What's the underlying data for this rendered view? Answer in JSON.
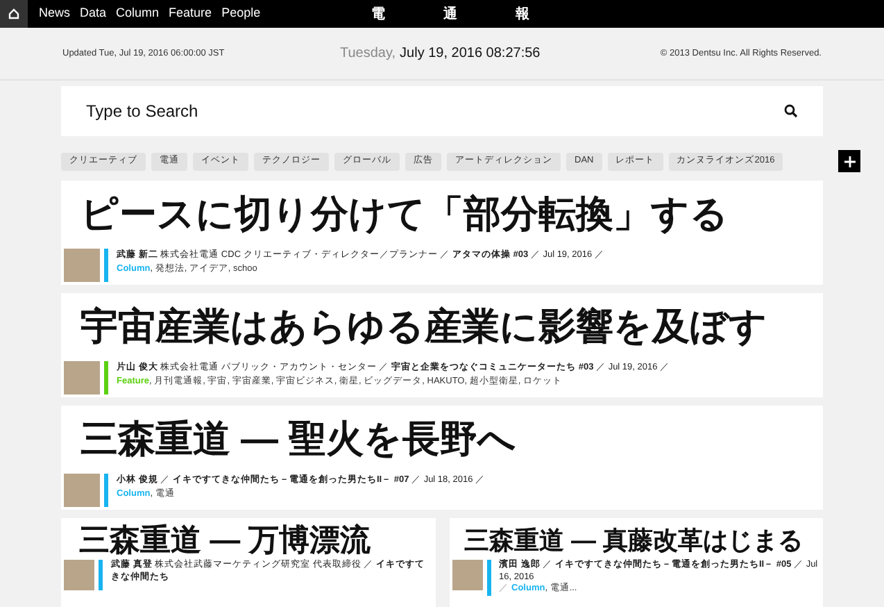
{
  "nav": {
    "items": [
      "News",
      "Data",
      "Column",
      "Feature",
      "People"
    ],
    "logo": [
      "電",
      "通",
      "報"
    ]
  },
  "info_bar": {
    "updated": "Updated Tue, Jul 19, 2016 06:00:00 JST",
    "weekday": "Tuesday,",
    "datetime": "July 19, 2016 08:27:56",
    "copyright": "© 2013 Dentsu Inc. All Rights Reserved."
  },
  "search": {
    "placeholder": "Type to Search"
  },
  "tags": [
    "クリエーティブ",
    "電通",
    "イベント",
    "テクノロジー",
    "グローバル",
    "広告",
    "アートディレクション",
    "DAN",
    "レポート",
    "カンヌライオンズ2016"
  ],
  "articles": [
    {
      "title": "ピースに切り分けて「部分転換」する",
      "meta": "**武藤 新二** 株式会社電通 CDC クリエーティブ・ディレクター／プランナー ／ **アタマの体操 #03** ／ Jul 19, 2016 ／",
      "category": "Column",
      "color": "#19b4f0",
      "rest": ", 発想法, アイデア, schoo"
    },
    {
      "title": "宇宙産業はあらゆる産業に影響を及ぼす",
      "meta": "**片山 俊大** 株式会社電通 パブリック・アカウント・センター ／ **宇宙と企業をつなぐコミュニケーターたち #03** ／ Jul 19, 2016 ／",
      "category": "Feature",
      "color": "#5cd012",
      "rest": ", 月刊電通報, 宇宙, 宇宙産業, 宇宙ビジネス, 衛星, ビッグデータ, HAKUTO, 超小型衛星, ロケット"
    },
    {
      "title": "三森重道 — 聖火を長野へ",
      "meta": "**小林 俊規** ／ **イキですてきな仲間たち－電通を創った男たちII－ #07** ／ Jul 18, 2016 ／",
      "category": "Column",
      "color": "#19b4f0",
      "rest": ", 電通"
    }
  ],
  "small_articles": [
    {
      "title": "三森重道 — 万博漂流",
      "meta": "**武藤 真登** 株式会社武藤マーケティング研究室 代表取締役 ／ **イキですてきな仲間たち**",
      "color": "#19b4f0"
    },
    {
      "title": "三森重道 — 真藤改革はじまる",
      "meta": "**濱田 逸郎** ／ **イキですてきな仲間たち－電通を創った男たちII－ #05** ／ Jul 16, 2016",
      "prefix": "／",
      "category": "Column",
      "rest": ", 電通...",
      "color": "#19b4f0"
    }
  ]
}
